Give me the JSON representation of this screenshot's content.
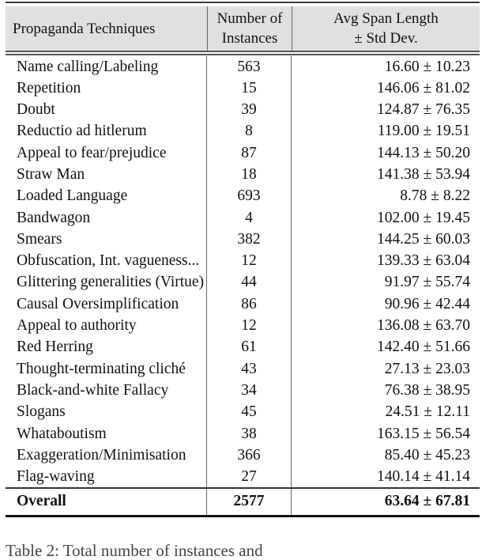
{
  "table": {
    "headers": {
      "technique": "Propaganda Techniques",
      "instances_line1": "Number of",
      "instances_line2": "Instances",
      "span_line1": "Avg Span Length",
      "span_line2": "± Std Dev."
    },
    "rows": [
      {
        "technique": "Name calling/Labeling",
        "instances": "563",
        "span": "16.60 ± 10.23"
      },
      {
        "technique": "Repetition",
        "instances": "15",
        "span": "146.06 ± 81.02"
      },
      {
        "technique": "Doubt",
        "instances": "39",
        "span": "124.87 ± 76.35"
      },
      {
        "technique": "Reductio ad hitlerum",
        "instances": "8",
        "span": "119.00 ± 19.51"
      },
      {
        "technique": "Appeal to fear/prejudice",
        "instances": "87",
        "span": "144.13 ± 50.20"
      },
      {
        "technique": "Straw Man",
        "instances": "18",
        "span": "141.38 ± 53.94"
      },
      {
        "technique": "Loaded Language",
        "instances": "693",
        "span": "8.78 ± 8.22"
      },
      {
        "technique": "Bandwagon",
        "instances": "4",
        "span": "102.00 ± 19.45"
      },
      {
        "technique": "Smears",
        "instances": "382",
        "span": "144.25 ± 60.03"
      },
      {
        "technique": "Obfuscation, Int. vagueness...",
        "instances": "12",
        "span": "139.33 ± 63.04"
      },
      {
        "technique": "Glittering generalities (Virtue)",
        "instances": "44",
        "span": "91.97 ± 55.74"
      },
      {
        "technique": "Causal Oversimplification",
        "instances": "86",
        "span": "90.96 ± 42.44"
      },
      {
        "technique": "Appeal to authority",
        "instances": "12",
        "span": "136.08 ± 63.70"
      },
      {
        "technique": "Red Herring",
        "instances": "61",
        "span": "142.40 ± 51.66"
      },
      {
        "technique": "Thought-terminating cliché",
        "instances": "43",
        "span": "27.13 ± 23.03"
      },
      {
        "technique": "Black-and-white Fallacy",
        "instances": "34",
        "span": "76.38 ± 38.95"
      },
      {
        "technique": "Slogans",
        "instances": "45",
        "span": "24.51 ± 12.11"
      },
      {
        "technique": "Whataboutism",
        "instances": "38",
        "span": "163.15 ± 56.54"
      },
      {
        "technique": "Exaggeration/Minimisation",
        "instances": "366",
        "span": "85.40 ± 45.23"
      },
      {
        "technique": "Flag-waving",
        "instances": "27",
        "span": "140.14 ± 41.14"
      }
    ],
    "overall": {
      "technique": "Overall",
      "instances": "2577",
      "span": "63.64 ± 67.81"
    }
  },
  "caption": "Table 2: Total number of instances and"
}
